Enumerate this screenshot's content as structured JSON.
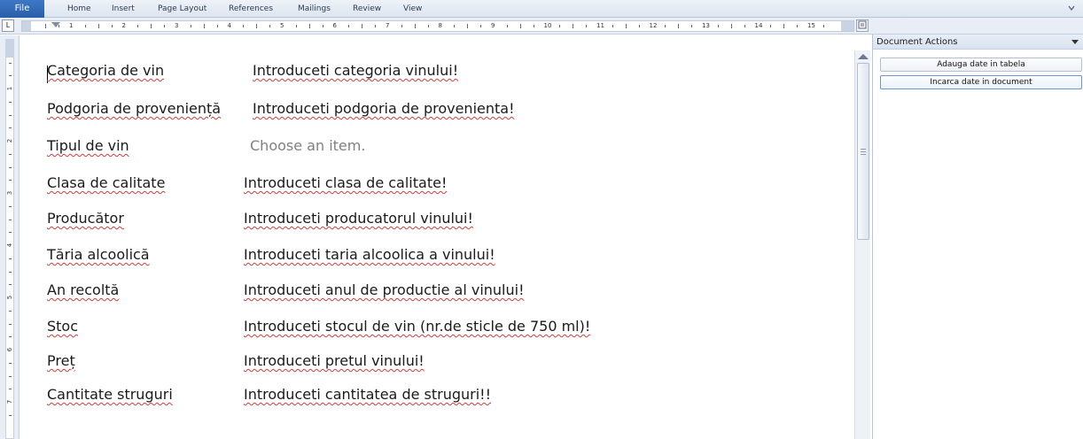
{
  "ribbon": {
    "tabs": [
      "File",
      "Home",
      "Insert",
      "Page Layout",
      "References",
      "Mailings",
      "Review",
      "View"
    ],
    "toggle_icon": "chevron-down-icon"
  },
  "ruler": {
    "tab_selector": "L",
    "numbers": [
      "1",
      "2",
      "3",
      "4",
      "5",
      "6",
      "7",
      "8",
      "9",
      "10",
      "11",
      "12",
      "13",
      "14",
      "15"
    ],
    "vertical_numbers": [
      "1",
      "2",
      "3",
      "4",
      "5",
      "6",
      "7"
    ]
  },
  "document": {
    "rows": [
      {
        "label": "Categoria de vin",
        "value": "Introduceti categoria vinului!"
      },
      {
        "label": "Podgoria de proveniență",
        "value": "Introduceti podgoria de provenienta!"
      },
      {
        "label": "Tipul de vin",
        "value": "Choose an item."
      },
      {
        "label": "Clasa de calitate",
        "value": "Introduceti clasa de calitate!"
      },
      {
        "label": "Producător",
        "value": "Introduceti producatorul vinului!"
      },
      {
        "label": "Tăria alcoolică",
        "value": "Introduceti taria alcoolica a vinului!"
      },
      {
        "label": "An recoltă",
        "value": "Introduceti anul de productie al vinului!"
      },
      {
        "label": "Stoc",
        "value": "Introduceti stocul de vin (nr.de sticle de 750 ml)!"
      },
      {
        "label": "Preț",
        "value": "Introduceti pretul vinului!"
      },
      {
        "label": "Cantitate struguri",
        "value": "Introduceti cantitatea de struguri!!"
      }
    ]
  },
  "task_pane": {
    "title": "Document Actions",
    "buttons": [
      "Adauga date in tabela",
      "Incarca date in document"
    ]
  },
  "colors": {
    "file_tab": "#2a5ea8",
    "spell_underline": "#d23b3b",
    "placeholder_text": "#808080"
  }
}
